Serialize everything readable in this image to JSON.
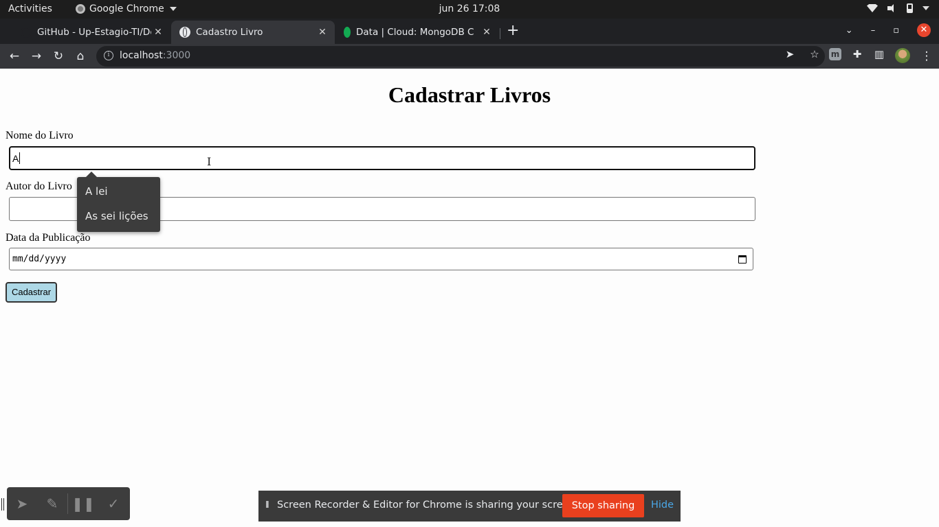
{
  "system_bar": {
    "activities": "Activities",
    "app_name": "Google Chrome",
    "clock": "jun 26  17:08"
  },
  "tabs": [
    {
      "title": "GitHub - Up-Estagio-TI/De",
      "active": false
    },
    {
      "title": "Cadastro Livro",
      "active": true
    },
    {
      "title": "Data | Cloud: MongoDB C",
      "active": false
    }
  ],
  "address_bar": {
    "host": "localhost",
    "port": ":3000"
  },
  "page": {
    "heading": "Cadastrar Livros",
    "book_name_label": "Nome do Livro",
    "book_name_value": "A",
    "author_label": "Autor do Livro",
    "author_value": "",
    "date_label": "Data da Publicação",
    "date_placeholder": "mm/dd/yyyy",
    "submit_label": "Cadastrar"
  },
  "autocomplete": {
    "items": [
      "A lei",
      "As sei lições"
    ]
  },
  "screen_share": {
    "pause_glyph": "II",
    "message": "Screen Recorder & Editor for Chrome is sharing your screen.",
    "stop_label": "Stop sharing",
    "hide_label": "Hide"
  },
  "colors": {
    "submit_bg": "#add8e6",
    "stop_sharing_bg": "#e9401e",
    "window_close": "#e8462e"
  }
}
